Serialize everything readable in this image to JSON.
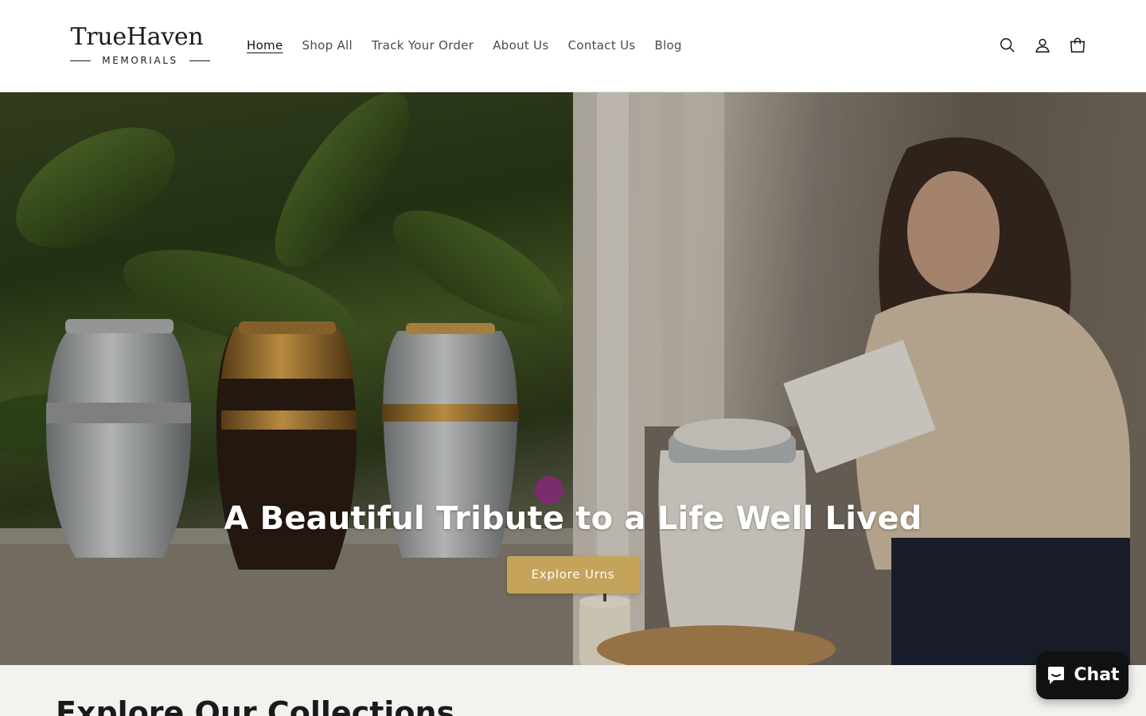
{
  "logo": {
    "name_true": "True",
    "name_haven": "Haven",
    "tagline": "MEMORIALS"
  },
  "nav": {
    "items": [
      {
        "label": "Home",
        "active": true
      },
      {
        "label": "Shop All",
        "active": false
      },
      {
        "label": "Track Your Order",
        "active": false
      },
      {
        "label": "About Us",
        "active": false
      },
      {
        "label": "Contact Us",
        "active": false
      },
      {
        "label": "Blog",
        "active": false
      }
    ]
  },
  "header_icons": [
    "search-icon",
    "account-icon",
    "cart-icon"
  ],
  "hero": {
    "title": "A Beautiful Tribute to a Life Well Lived",
    "button_label": "Explore Urns",
    "button_color": "#c5a35a"
  },
  "collections": {
    "title": "Explore Our Collections"
  },
  "chat": {
    "label": "Chat",
    "icon": "chat-bubble-icon"
  },
  "colors": {
    "accent": "#c5a35a",
    "text": "#121212",
    "nav_text": "#4a4a4a",
    "section_bg": "#f4f2ef",
    "chat_bg": "#111111"
  }
}
